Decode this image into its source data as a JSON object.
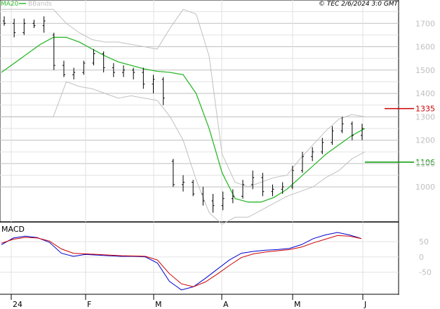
{
  "header": {
    "copyright": "© TEC 2/6/2024 3:0 GMT"
  },
  "legend": {
    "ma20_label": "MA20",
    "bbands_label": "BBands",
    "ma20_color": "#2db82d",
    "bbands_color": "#c0c0c0"
  },
  "chart_data": [
    {
      "type": "candlestick",
      "title": "",
      "ylim": [
        850,
        1800
      ],
      "yticks": [
        1000,
        1100,
        1200,
        1300,
        1400,
        1500,
        1600,
        1700
      ],
      "ytick_labels": [
        "1000",
        "1100",
        "1200",
        "1300",
        "1400",
        "1500",
        "1600",
        "1700"
      ],
      "xtick_labels": [
        "24",
        "F",
        "M",
        "A",
        "M",
        "J"
      ],
      "grid": true,
      "levels": [
        {
          "label": "1335",
          "value": 1335,
          "color": "#cc0000"
        },
        {
          "label": "1106",
          "value": 1106,
          "color": "#009900"
        }
      ],
      "series": [
        {
          "name": "MA20",
          "color": "#2db82d",
          "values": [
            1490,
            1530,
            1570,
            1610,
            1640,
            1640,
            1620,
            1590,
            1560,
            1535,
            1520,
            1505,
            1495,
            1490,
            1480,
            1400,
            1250,
            1060,
            950,
            935,
            935,
            955,
            990,
            1040,
            1090,
            1140,
            1180,
            1220,
            1250
          ]
        },
        {
          "name": "BBands",
          "color": "#c0c0c0",
          "upper": [
            1760,
            1760,
            1760,
            1760,
            1760,
            1700,
            1660,
            1630,
            1620,
            1620,
            1610,
            1600,
            1590,
            1680,
            1760,
            1740,
            1560,
            1140,
            1020,
            1000,
            1020,
            1040,
            1050,
            1120,
            1180,
            1240,
            1290,
            1310,
            1300
          ],
          "lower": [
            1300,
            1300,
            1300,
            1300,
            1300,
            1450,
            1430,
            1420,
            1400,
            1380,
            1390,
            1380,
            1370,
            1300,
            1200,
            1030,
            890,
            840,
            870,
            870,
            900,
            930,
            960,
            980,
            1000,
            1040,
            1070,
            1120,
            1150
          ]
        }
      ],
      "ohlc": [
        [
          1710,
          1730,
          1690,
          1700
        ],
        [
          1700,
          1720,
          1640,
          1660
        ],
        [
          1660,
          1720,
          1650,
          1700
        ],
        [
          1700,
          1715,
          1680,
          1690
        ],
        [
          1690,
          1730,
          1660,
          1710
        ],
        [
          1650,
          1660,
          1500,
          1520
        ],
        [
          1520,
          1540,
          1470,
          1480
        ],
        [
          1480,
          1510,
          1460,
          1490
        ],
        [
          1490,
          1540,
          1480,
          1530
        ],
        [
          1530,
          1590,
          1520,
          1570
        ],
        [
          1570,
          1580,
          1490,
          1510
        ],
        [
          1510,
          1530,
          1470,
          1490
        ],
        [
          1490,
          1520,
          1470,
          1500
        ],
        [
          1500,
          1510,
          1460,
          1490
        ],
        [
          1490,
          1510,
          1420,
          1440
        ],
        [
          1440,
          1480,
          1400,
          1460
        ],
        [
          1460,
          1470,
          1350,
          1380
        ],
        [
          1110,
          1120,
          1000,
          1010
        ],
        [
          1010,
          1050,
          980,
          1020
        ],
        [
          1020,
          1030,
          960,
          970
        ],
        [
          970,
          1000,
          920,
          940
        ],
        [
          940,
          970,
          890,
          920
        ],
        [
          920,
          980,
          900,
          950
        ],
        [
          950,
          990,
          930,
          960
        ],
        [
          960,
          1030,
          950,
          1010
        ],
        [
          1010,
          1070,
          990,
          1040
        ],
        [
          1040,
          1060,
          960,
          980
        ],
        [
          980,
          1010,
          960,
          990
        ],
        [
          990,
          1020,
          970,
          1000
        ],
        [
          1000,
          1090,
          990,
          1070
        ],
        [
          1070,
          1150,
          1060,
          1130
        ],
        [
          1130,
          1170,
          1110,
          1150
        ],
        [
          1150,
          1210,
          1140,
          1190
        ],
        [
          1190,
          1260,
          1180,
          1240
        ],
        [
          1240,
          1300,
          1230,
          1270
        ],
        [
          1270,
          1280,
          1200,
          1220
        ],
        [
          1220,
          1270,
          1200,
          1250
        ]
      ]
    },
    {
      "type": "line",
      "title": "MACD",
      "ylim": [
        -120,
        110
      ],
      "yticks": [
        50,
        0,
        -50
      ],
      "ytick_labels": [
        "50",
        "0",
        "-50"
      ],
      "series": [
        {
          "name": "MACD",
          "color": "#0000cc",
          "values": [
            40,
            62,
            68,
            63,
            48,
            12,
            2,
            8,
            6,
            4,
            2,
            2,
            0,
            -20,
            -80,
            -108,
            -98,
            -70,
            -40,
            -10,
            12,
            18,
            22,
            24,
            28,
            40,
            60,
            72,
            80,
            72,
            60
          ]
        },
        {
          "name": "Signal",
          "color": "#cc0000",
          "values": [
            45,
            58,
            64,
            62,
            52,
            26,
            12,
            10,
            8,
            6,
            4,
            3,
            2,
            -10,
            -55,
            -88,
            -98,
            -82,
            -56,
            -28,
            -2,
            10,
            16,
            20,
            24,
            32,
            46,
            58,
            70,
            68,
            60
          ]
        }
      ]
    }
  ]
}
